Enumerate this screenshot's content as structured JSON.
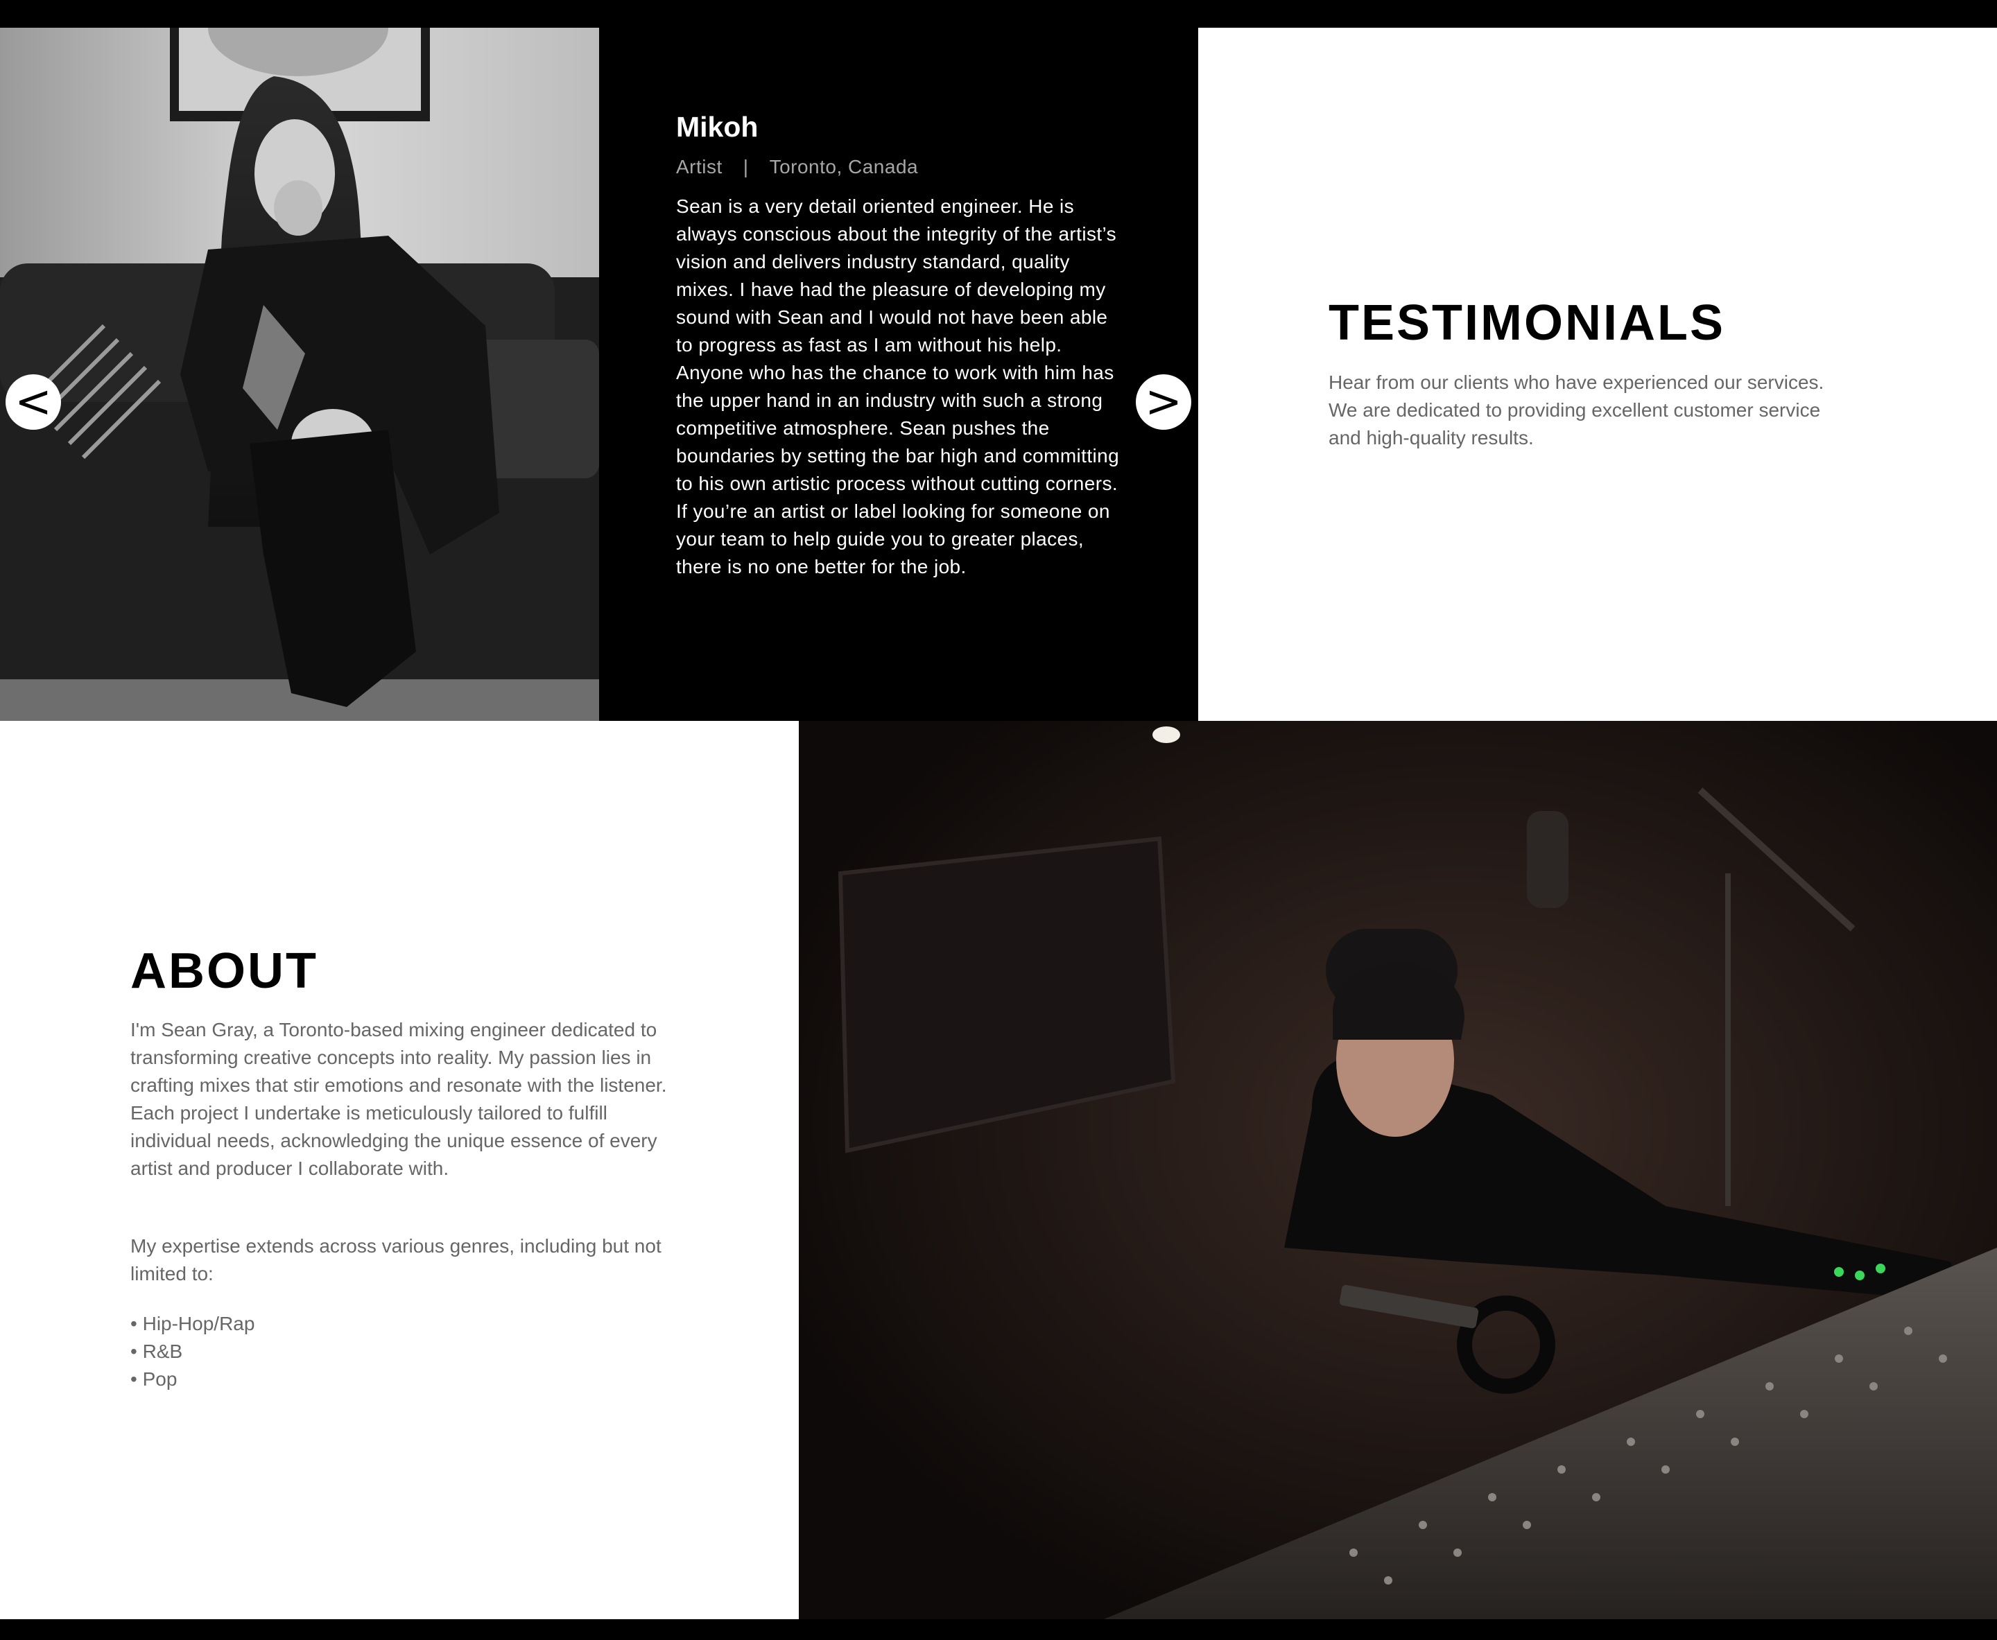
{
  "testimonial": {
    "client_name": "Mikoh",
    "client_role": "Artist",
    "separator": "|",
    "client_location": "Toronto, Canada",
    "quote": "Sean is a very detail oriented engineer. He is always conscious about the integrity of the artist’s vision and delivers industry standard, quality mixes. I have had the pleasure of developing my sound with Sean and I would not have been able to progress as fast as I am without his help. Anyone who has the chance to work with him has the upper hand in an industry with such a strong competitive atmosphere. Sean pushes the boundaries by setting the bar high and committing to his own artistic process without cutting corners. If you’re an artist or label looking for someone on your team to help guide you to greater places, there is no one better for the job.",
    "prev_label": "<",
    "next_label": ">"
  },
  "testimonials_section": {
    "title": "TESTIMONIALS",
    "description": "Hear from our clients who have experienced our services. We are dedicated to providing excellent customer service and high-quality results."
  },
  "about": {
    "title": "ABOUT",
    "paragraph_1": "I'm Sean Gray, a Toronto-based mixing engineer dedicated to transforming creative concepts into reality. My passion lies in crafting mixes that stir emotions and resonate with the listener. Each project I undertake is meticulously tailored to fulfill individual needs, acknowledging the unique essence of every artist and producer I collaborate with.",
    "paragraph_2": "My expertise extends across various genres, including but not limited to:",
    "genres": [
      "Hip-Hop/Rap",
      "R&B",
      "Pop"
    ]
  },
  "colors": {
    "background_dark": "#000000",
    "panel_light": "#ffffff",
    "body_text_gray": "#666666",
    "meta_text_gray": "#a7a7a7"
  }
}
